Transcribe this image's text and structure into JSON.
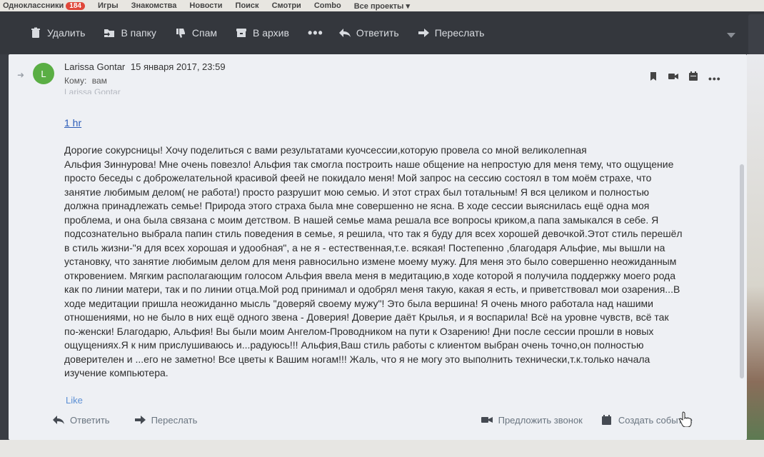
{
  "portal": {
    "site_name": "Одноклассники",
    "badge": "184",
    "items": [
      "Игры",
      "Знакомства",
      "Новости",
      "Поиск",
      "Смотри",
      "Combo",
      "Все проекты ▾"
    ]
  },
  "toolbar": {
    "delete": "Удалить",
    "to_folder": "В папку",
    "spam": "Спам",
    "archive": "В архив",
    "more": "•••",
    "reply": "Ответить",
    "forward": "Переслать"
  },
  "message": {
    "avatar_letter": "L",
    "sender": "Larissa Gontar",
    "date": "15 января 2017, 23:59",
    "to_label": "Кому:",
    "to_value": "вам",
    "cut_name": "Larissa Gontar",
    "link_1hr": "1 hr",
    "lines": [
      "Дорогие сокурсницы! Хочу поделиться с вами результатами куочсессии,которую провела со мной великолепная",
      "Альфия Зиннурова! Мне очень повезло! Альфия так смогла построить наше общение на непростую для меня тему, что ощущение",
      "просто беседы с доброжелательной красивой феей не покидало меня! Мой запрос на сессию состоял в том моём страхе, что",
      "занятие любимым делом( не работа!) просто разрушит мою семью. И этот страх был тотальным! Я вся целиком и полностью",
      "должна принадлежать семье! Природа этого страха была мне совершенно не ясна. В ходе сессии выяснилась ещё одна моя",
      "проблема, и она была связана с моим детством. В нашей семье мама решала все вопросы криком,а папа замыкался в себе. Я",
      "подсознательно выбрала папин стиль поведения в семье, я решила, что так я буду для всех хорошей девочкой.Этот стиль перешёл",
      "в стиль жизни-\"я для всех хорошая и удообная\", а не я - естественная,т.е. всякая! Постепенно ,благодаря Альфие, мы вышли на",
      "установку, что занятие любимым делом для меня равносильно измене моему мужу. Для меня это было совершенно неожиданным",
      "откровением. Мягким располагающим голосом Альфия ввела меня в медитацию,в ходе которой я получила поддержку моего рода",
      "как по линии матери, так и по линии отца.Мой род принимал и одобрял меня такую, какая я есть, и приветствовал мои озарения...В",
      "ходе медитации пришла неожиданно мысль \"доверяй своему мужу\"! Это была вершина! Я очень много работала над нашими",
      "отношениями, но не было в них ещё одного звена - Доверия! Доверие даёт Крылья, и я воспарила! Всё на уровне чувств, всё так",
      "по-женски! Благодарю, Альфия! Вы были моим Ангелом-Проводником на пути к Озарению! Дни после сессии прошли в новых",
      "ощущениях.Я к ним прислушиваюсь и...радуюсь!!! Альфия,Ваш стиль работы с клиентом выбран очень точно,он полностью",
      "доверителен и ...его не заметно! Все цветы к Вашим ногам!!! Жаль, что я не могу это выполнить технически,т.к.только начала",
      "изучение компьютера."
    ],
    "like": "Like"
  },
  "footer": {
    "reply": "Ответить",
    "forward": "Переслать",
    "suggest_call": "Предложить звонок",
    "create_event": "Создать событие"
  }
}
